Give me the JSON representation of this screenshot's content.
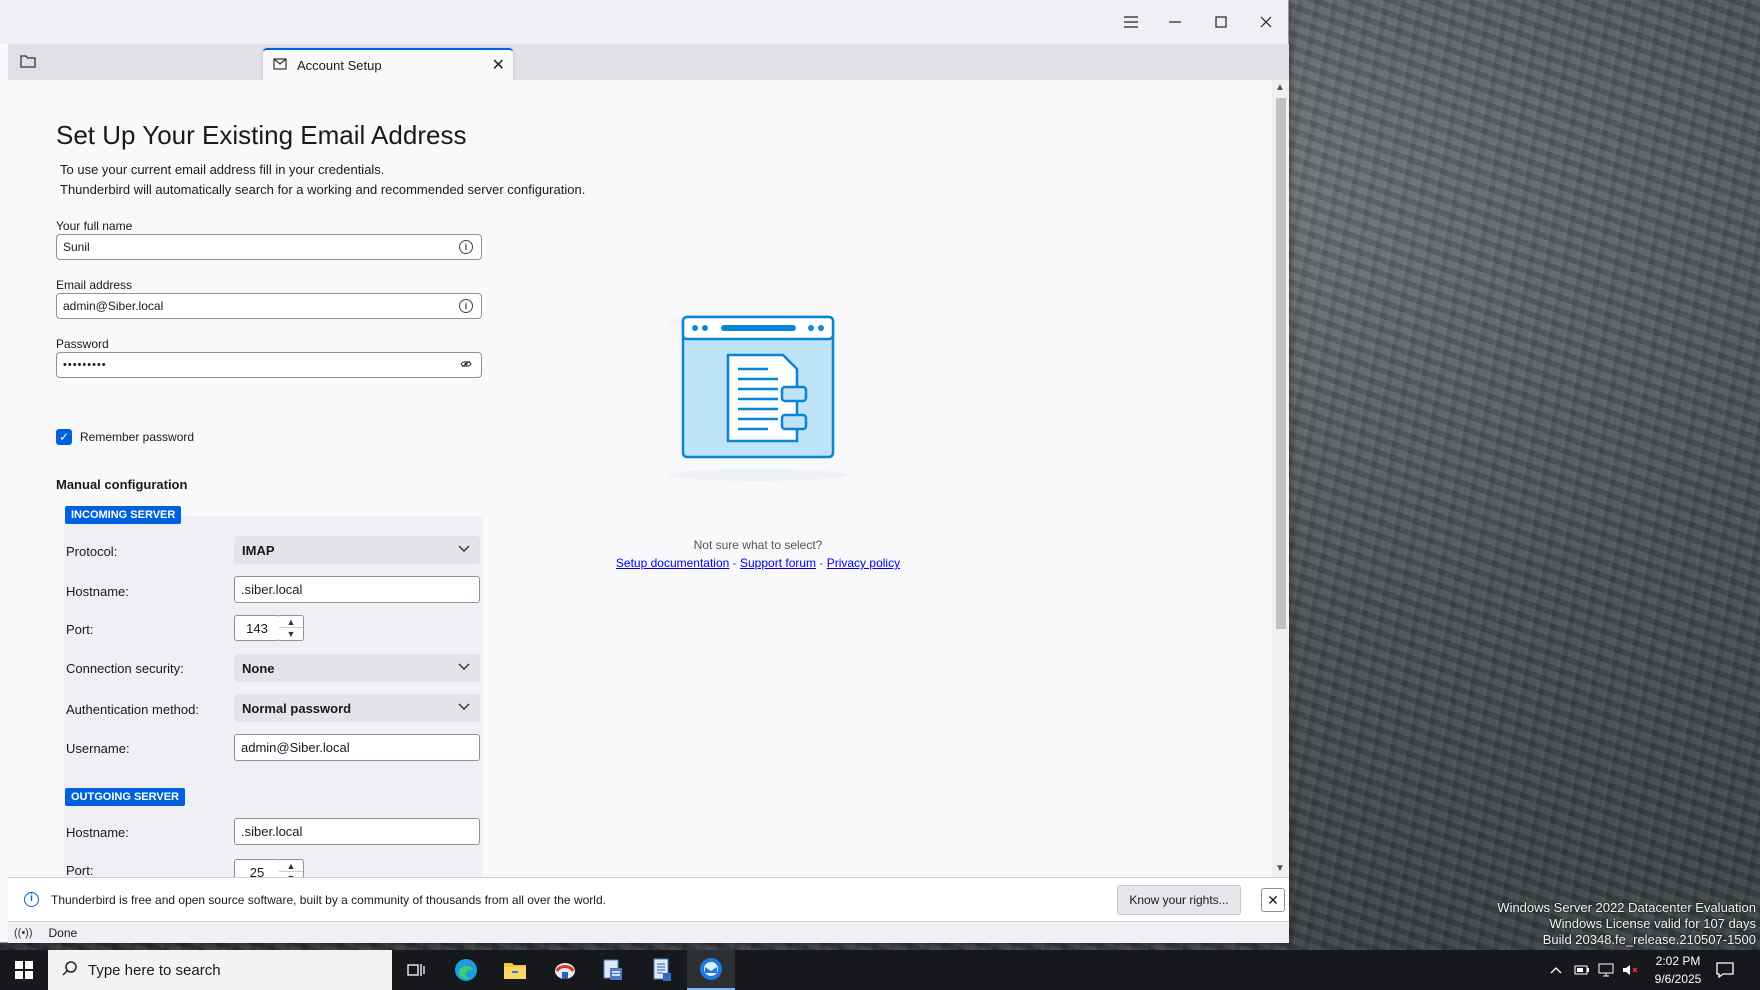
{
  "window": {
    "tab_title": "Account Setup"
  },
  "page": {
    "title": "Set Up Your Existing Email Address",
    "intro_line1": "To use your current email address fill in your credentials.",
    "intro_line2": "Thunderbird will automatically search for a working and recommended server configuration."
  },
  "form": {
    "full_name_label": "Your full name",
    "full_name_value": "Sunil",
    "email_label": "Email address",
    "email_value": "admin@Siber.local",
    "password_label": "Password",
    "password_value": "•••••••••",
    "remember_label": "Remember password",
    "remember_checked": true
  },
  "manual": {
    "title": "Manual configuration",
    "incoming": {
      "badge": "INCOMING SERVER",
      "protocol_label": "Protocol:",
      "protocol_value": "IMAP",
      "hostname_label": "Hostname:",
      "hostname_value": ".siber.local",
      "port_label": "Port:",
      "port_value": "143",
      "security_label": "Connection security:",
      "security_value": "None",
      "auth_label": "Authentication method:",
      "auth_value": "Normal password",
      "username_label": "Username:",
      "username_value": "admin@Siber.local"
    },
    "outgoing": {
      "badge": "OUTGOING SERVER",
      "hostname_label": "Hostname:",
      "hostname_value": ".siber.local",
      "port_label": "Port:",
      "port_value": "25"
    }
  },
  "help": {
    "question": "Not sure what to select?",
    "link_docs": "Setup documentation",
    "sep1": " - ",
    "link_forum": "Support forum",
    "sep2": " - ",
    "link_privacy": "Privacy policy"
  },
  "notification": {
    "text": "Thunderbird is free and open source software, built by a community of thousands from all over the world.",
    "button": "Know your rights..."
  },
  "status": {
    "text": "Done"
  },
  "taskbar": {
    "search_placeholder": "Type here to search",
    "time": "2:02 PM",
    "date": "9/6/2025"
  },
  "watermark": {
    "line1": "Windows Server 2022 Datacenter Evaluation",
    "line2": "Windows License valid for 107 days",
    "line3": "Build 20348.fe_release.210507-1500"
  },
  "colors": {
    "accent": "#0061e0",
    "illustration": "#0a84d6"
  },
  "icons": [
    "menu-icon",
    "minimize-icon",
    "maximize-icon",
    "close-icon",
    "folder-icon",
    "account-setup-icon",
    "info-icon",
    "eye-icon",
    "chevron-down-icon",
    "windows-start-icon",
    "search-icon"
  ]
}
